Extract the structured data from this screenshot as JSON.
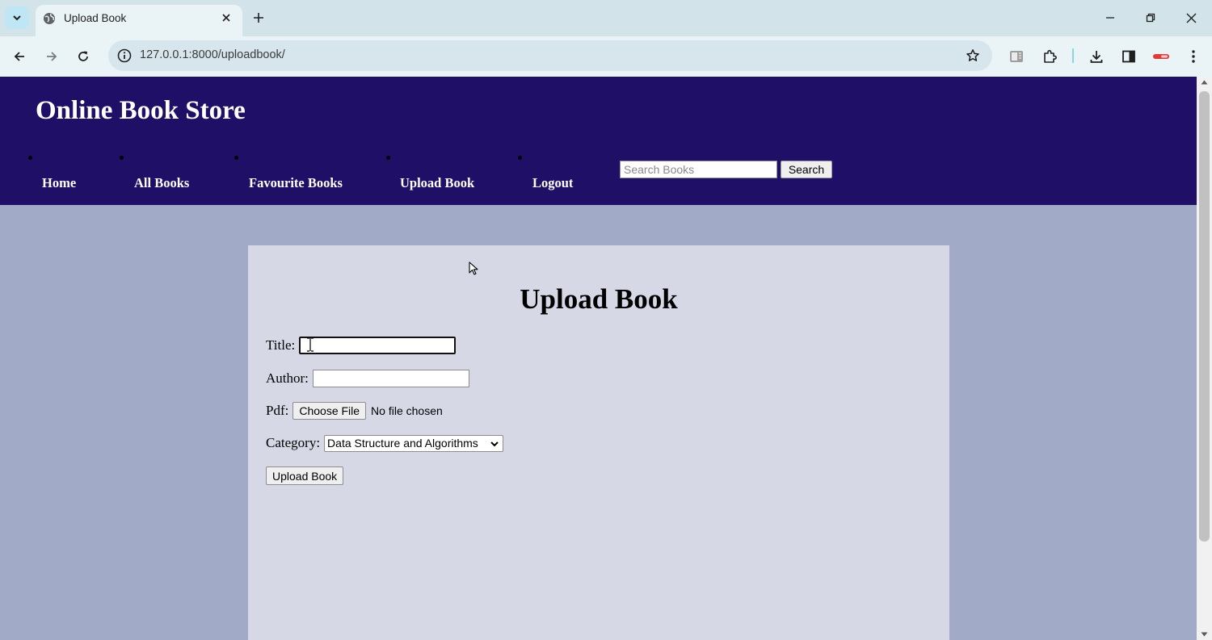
{
  "browser": {
    "tab_title": "Upload Book",
    "url": "127.0.0.1:8000/uploadbook/"
  },
  "site": {
    "title": "Online Book Store",
    "nav": [
      {
        "label": "Home"
      },
      {
        "label": "All Books"
      },
      {
        "label": "Favourite Books"
      },
      {
        "label": "Upload Book"
      },
      {
        "label": "Logout"
      }
    ],
    "search": {
      "placeholder": "Search Books",
      "button_label": "Search"
    }
  },
  "form": {
    "heading": "Upload Book",
    "title_label": "Title:",
    "title_value": "",
    "author_label": "Author:",
    "author_value": "",
    "pdf_label": "Pdf:",
    "file_button_label": "Choose File",
    "file_status": "No file chosen",
    "category_label": "Category:",
    "category_selected": "Data Structure and Algorithms",
    "submit_label": "Upload Book"
  },
  "colors": {
    "header_bg": "#1f0f66",
    "page_bg": "#a1aac7",
    "card_bg": "#d6d9e5"
  }
}
